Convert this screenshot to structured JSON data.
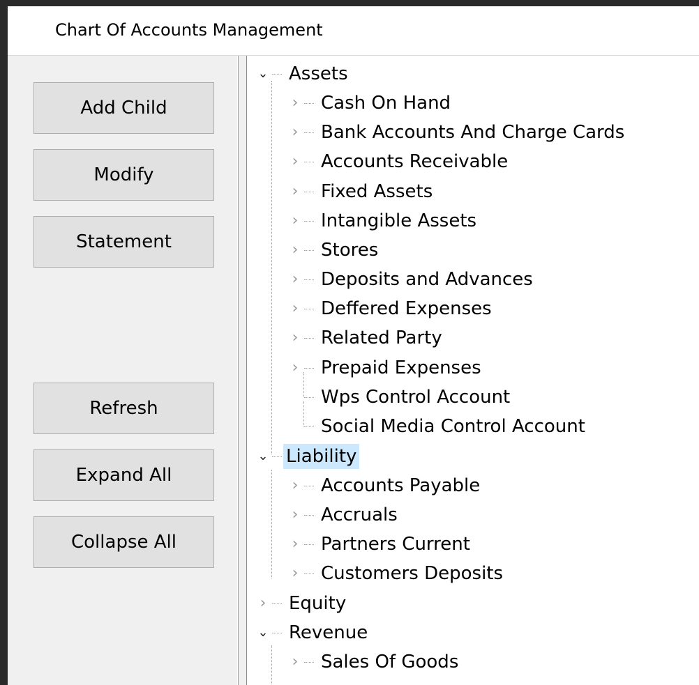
{
  "window": {
    "title": "Chart Of Accounts Management"
  },
  "buttons": {
    "add_child": "Add Child",
    "modify": "Modify",
    "statement": "Statement",
    "refresh": "Refresh",
    "expand_all": "Expand All",
    "collapse_all": "Collapse All"
  },
  "tree": {
    "assets": {
      "label": "Assets",
      "children": [
        "Cash On Hand",
        "Bank Accounts And Charge Cards",
        "Accounts Receivable",
        "Fixed Assets",
        "Intangible Assets",
        "Stores",
        "Deposits and Advances",
        "Deffered Expenses",
        "Related Party",
        "Prepaid Expenses",
        "Wps Control Account",
        "Social Media Control Account"
      ]
    },
    "liability": {
      "label": "Liability",
      "children": [
        "Accounts Payable",
        "Accruals",
        "Partners Current",
        "Customers Deposits"
      ]
    },
    "equity": {
      "label": "Equity"
    },
    "revenue": {
      "label": "Revenue",
      "children": [
        "Sales Of Goods"
      ]
    },
    "expand_glyph": "✕",
    "open_glyph": "⌄",
    "closed_glyph": "›"
  },
  "colors": {
    "selection": "#cce8ff",
    "button_face": "#e1e1e1",
    "button_border": "#adadad",
    "window_bg": "#f0f0f0"
  }
}
